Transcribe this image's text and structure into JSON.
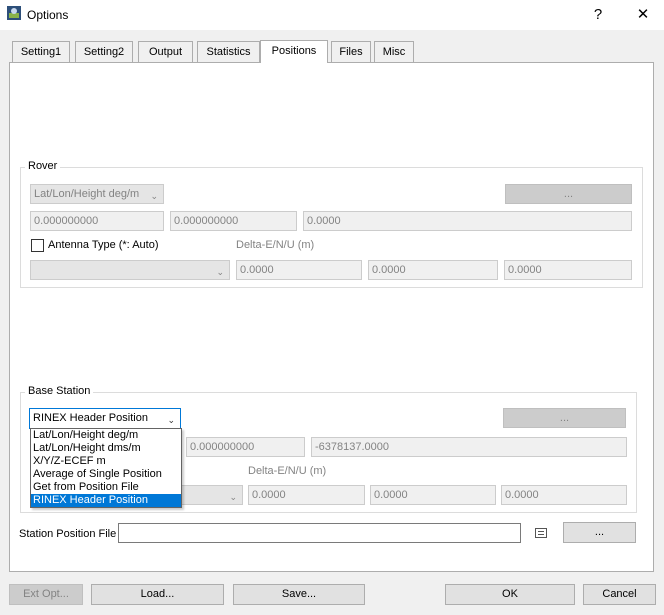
{
  "window": {
    "title": "Options",
    "help_glyph": "?",
    "close_glyph": "✕"
  },
  "tabs": [
    {
      "label": "Setting1"
    },
    {
      "label": "Setting2"
    },
    {
      "label": "Output"
    },
    {
      "label": "Statistics"
    },
    {
      "label": "Positions"
    },
    {
      "label": "Files"
    },
    {
      "label": "Misc"
    }
  ],
  "active_tab": "Positions",
  "rover": {
    "title": "Rover",
    "pos_type": "Lat/Lon/Height deg/m",
    "browse_label": "...",
    "pos1": "0.000000000",
    "pos2": "0.000000000",
    "pos3": "0.0000",
    "antenna_label": "Antenna Type (*: Auto)",
    "antenna_checked": false,
    "antenna_type": "",
    "delta_label": "Delta-E/N/U (m)",
    "delta_e": "0.0000",
    "delta_n": "0.0000",
    "delta_u": "0.0000"
  },
  "base": {
    "title": "Base Station",
    "pos_type": "RINEX Header Position",
    "browse_label": "...",
    "pos2": "0.000000000",
    "pos3": "-6378137.0000",
    "delta_label": "Delta-E/N/U (m)",
    "delta_e": "0.0000",
    "delta_n": "0.0000",
    "delta_u": "0.0000",
    "dropdown_options": [
      "Lat/Lon/Height deg/m",
      "Lat/Lon/Height dms/m",
      "X/Y/Z-ECEF m",
      "Average of Single Position",
      "Get from Position File",
      "RINEX Header Position"
    ],
    "dropdown_selected": "RINEX Header Position"
  },
  "station_file": {
    "label": "Station Position File",
    "value": "",
    "browse_label": "..."
  },
  "buttons": {
    "ext_opt": "Ext Opt...",
    "load": "Load...",
    "save": "Save...",
    "ok": "OK",
    "cancel": "Cancel"
  },
  "colors": {
    "accent": "#0078d7",
    "disabled_text": "#838383"
  }
}
